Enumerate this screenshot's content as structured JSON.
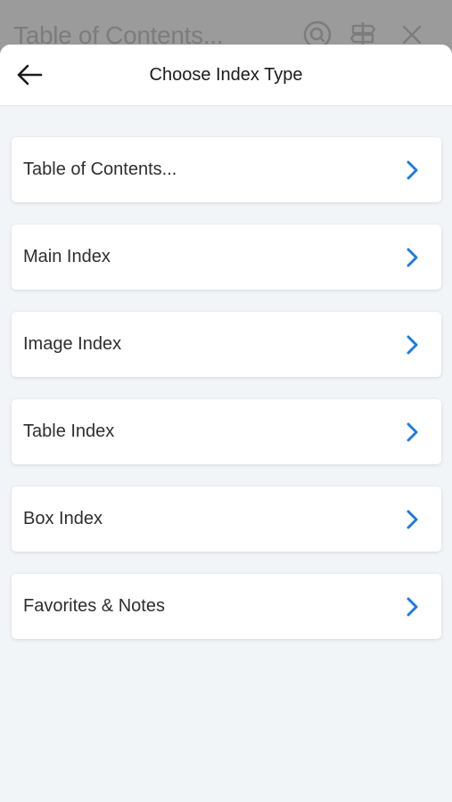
{
  "background": {
    "title": "Table of Contents...",
    "icons": [
      "search-icon",
      "signpost-icon",
      "close-icon"
    ]
  },
  "header": {
    "title": "Choose Index Type",
    "back_icon": "arrow-left-icon"
  },
  "items": [
    {
      "label": "Table of Contents..."
    },
    {
      "label": "Main Index"
    },
    {
      "label": "Image Index"
    },
    {
      "label": "Table Index"
    },
    {
      "label": "Box Index"
    },
    {
      "label": "Favorites & Notes"
    }
  ],
  "colors": {
    "accent": "#1f7ae0",
    "sheet_background": "#f2f5f8",
    "card": "#ffffff"
  }
}
